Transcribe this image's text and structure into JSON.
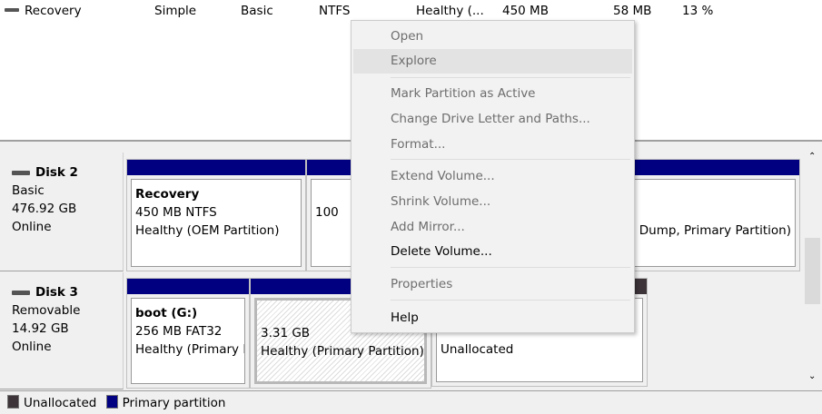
{
  "volume_row": {
    "name": "Recovery",
    "layout": "Simple",
    "type": "Basic",
    "fs": "NTFS",
    "status": "Healthy (...",
    "capacity": "450 MB",
    "free": "58 MB",
    "pct_free": "13 %"
  },
  "disks": [
    {
      "name": "Disk 2",
      "type": "Basic",
      "size": "476.92 GB",
      "state": "Online",
      "partitions": [
        {
          "title": "Recovery",
          "line1": "450 MB NTFS",
          "line2": "Healthy (OEM Partition)"
        },
        {
          "title": "",
          "line1": "100",
          "line2": ""
        },
        {
          "title": "",
          "line1": "",
          "line2": "Dump, Primary Partition)"
        }
      ]
    },
    {
      "name": "Disk 3",
      "type": "Removable",
      "size": "14.92 GB",
      "state": "Online",
      "partitions": [
        {
          "title": "boot  (G:)",
          "line1": "256 MB FAT32",
          "line2": "Healthy (Primary P"
        },
        {
          "title": "",
          "line1": "3.31 GB",
          "line2": "Healthy (Primary Partition)"
        },
        {
          "title": "",
          "line1": "Unallocated",
          "line2": ""
        }
      ]
    }
  ],
  "menu": {
    "items": [
      "Open",
      "Explore",
      "Mark Partition as Active",
      "Change Drive Letter and Paths...",
      "Format...",
      "Extend Volume...",
      "Shrink Volume...",
      "Add Mirror...",
      "Delete Volume...",
      "Properties",
      "Help"
    ],
    "enabled": [
      "Delete Volume...",
      "Help"
    ],
    "highlighted": "Explore"
  },
  "legend": {
    "unallocated": "Unallocated",
    "primary": "Primary partition"
  },
  "colors": {
    "primary": "#000080",
    "unallocated": "#3c3438"
  }
}
